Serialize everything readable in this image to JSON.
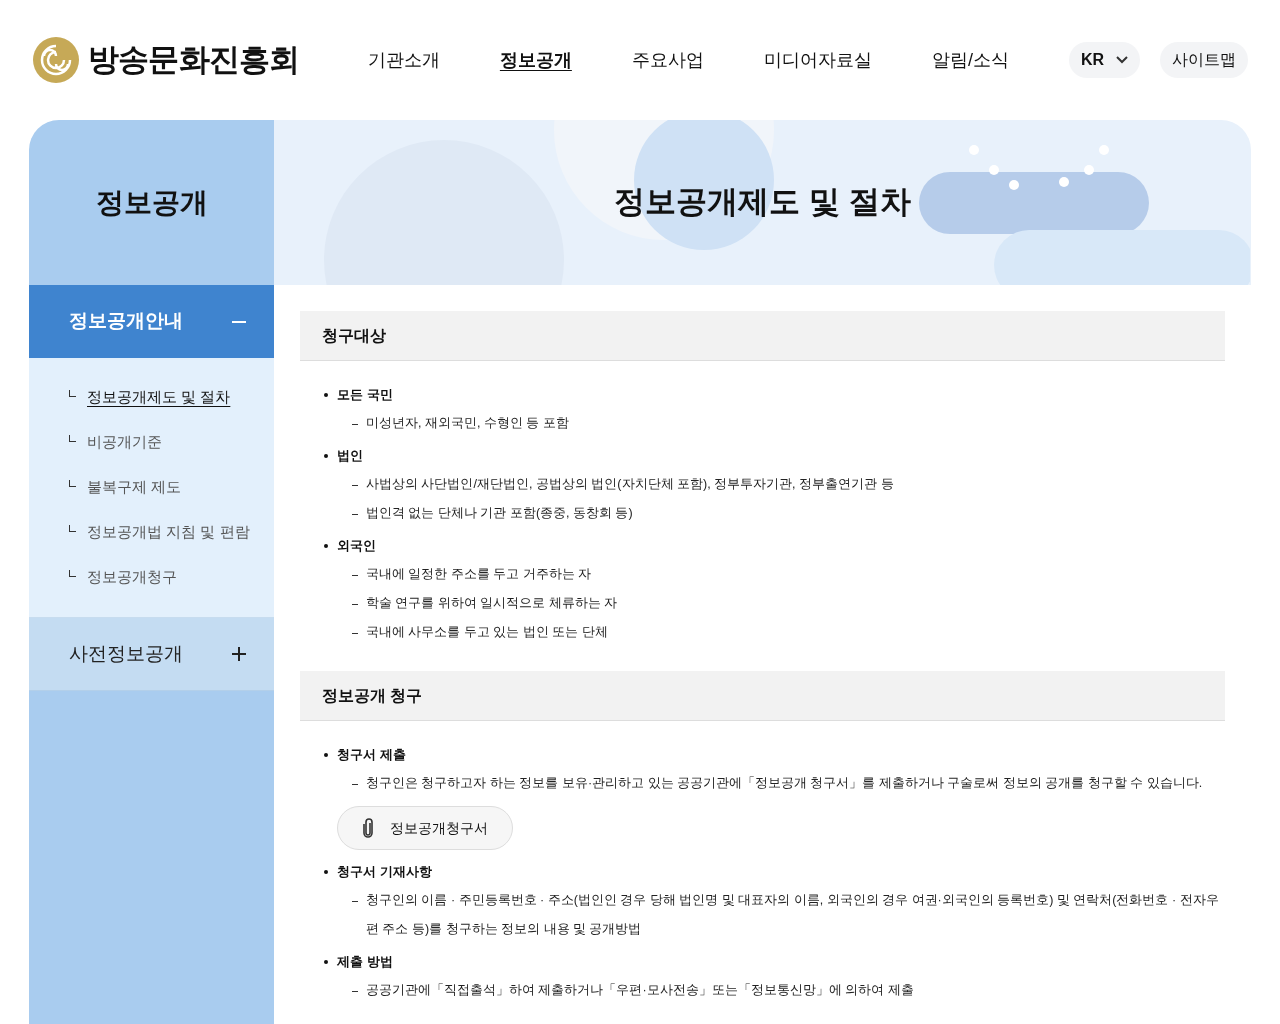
{
  "header": {
    "logo": "방송문화진흥회",
    "nav": [
      {
        "label": "기관소개",
        "selected": false
      },
      {
        "label": "정보공개",
        "selected": true
      },
      {
        "label": "주요사업",
        "selected": false
      },
      {
        "label": "미디어자료실",
        "selected": false
      },
      {
        "label": "알림/소식",
        "selected": false
      }
    ],
    "language": "KR",
    "sitemap": "사이트맵"
  },
  "sidebar": {
    "title": "정보공개",
    "groups": [
      {
        "label": "정보공개안내",
        "expanded": true,
        "children": [
          {
            "label": "정보공개제도 및 절차",
            "selected": true
          },
          {
            "label": "비공개기준",
            "selected": false
          },
          {
            "label": "불복구제 제도",
            "selected": false
          },
          {
            "label": "정보공개법 지침 및 편람",
            "selected": false
          },
          {
            "label": "정보공개청구",
            "selected": false
          }
        ]
      },
      {
        "label": "사전정보공개",
        "expanded": false
      }
    ]
  },
  "banner": {
    "title": "정보공개제도 및 절차"
  },
  "sections": [
    {
      "title": "청구대상",
      "items": [
        {
          "heading": "모든 국민",
          "lines": [
            "미성년자, 재외국민, 수형인 등 포함"
          ]
        },
        {
          "heading": "법인",
          "lines": [
            "사법상의 사단법인/재단법인, 공법상의 법인(자치단체 포함), 정부투자기관, 정부출연기관 등",
            "법인격 없는 단체나 기관 포함(종중, 동창회 등)"
          ]
        },
        {
          "heading": "외국인",
          "lines": [
            "국내에 일정한 주소를 두고 거주하는 자",
            "학술 연구를 위하여 일시적으로 체류하는 자",
            "국내에 사무소를 두고 있는 법인 또는 단체"
          ]
        }
      ]
    },
    {
      "title": "정보공개 청구",
      "items": [
        {
          "heading": "청구서 제출",
          "lines": [
            "청구인은 청구하고자 하는 정보를 보유·관리하고 있는 공공기관에「정보공개 청구서」를 제출하거나 구술로써 정보의 공개를 청구할 수 있습니다."
          ],
          "attachment": "정보공개청구서"
        },
        {
          "heading": "청구서 기재사항",
          "lines": [
            "청구인의 이름 · 주민등록번호 · 주소(법인인 경우 당해 법인명 및 대표자의 이름, 외국인의 경우 여권·외국인의 등록번호) 및 연락처(전화번호 · 전자우편 주소 등)를 청구하는 정보의 내용 및 공개방법"
          ]
        },
        {
          "heading": "제출 방법",
          "lines": [
            "공공기관에「직접출석」하여 제출하거나「우편·모사전송」또는「정보통신망」에 의하여 제출"
          ]
        }
      ]
    }
  ]
}
